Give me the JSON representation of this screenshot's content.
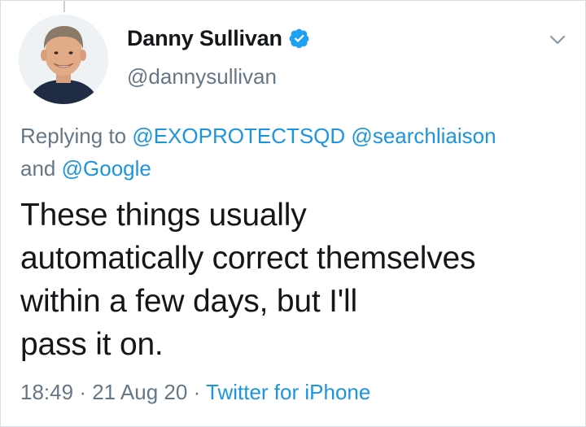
{
  "tweet": {
    "author": {
      "display_name": "Danny Sullivan",
      "handle": "@dannysullivan",
      "verified": true,
      "avatar_icon": "profile-photo"
    },
    "reply_context": {
      "prefix": "Replying to",
      "mentions": [
        "@EXOPROTECTSQD",
        "@searchliaison",
        "@Google"
      ],
      "conjunction": "and"
    },
    "text_lines": [
      "These things usually",
      "automatically correct themselves",
      "within a few days, but I'll",
      "pass it on."
    ],
    "time": "18:49",
    "date": "21 Aug 20",
    "separator": "·",
    "source": "Twitter for iPhone"
  },
  "icons": {
    "verified": "verified-badge-icon",
    "menu": "chevron-down-icon"
  },
  "colors": {
    "link": "#1b95e0",
    "secondary_text": "#657786",
    "primary_text": "#14171a",
    "verified_badge": "#1da1f2"
  }
}
